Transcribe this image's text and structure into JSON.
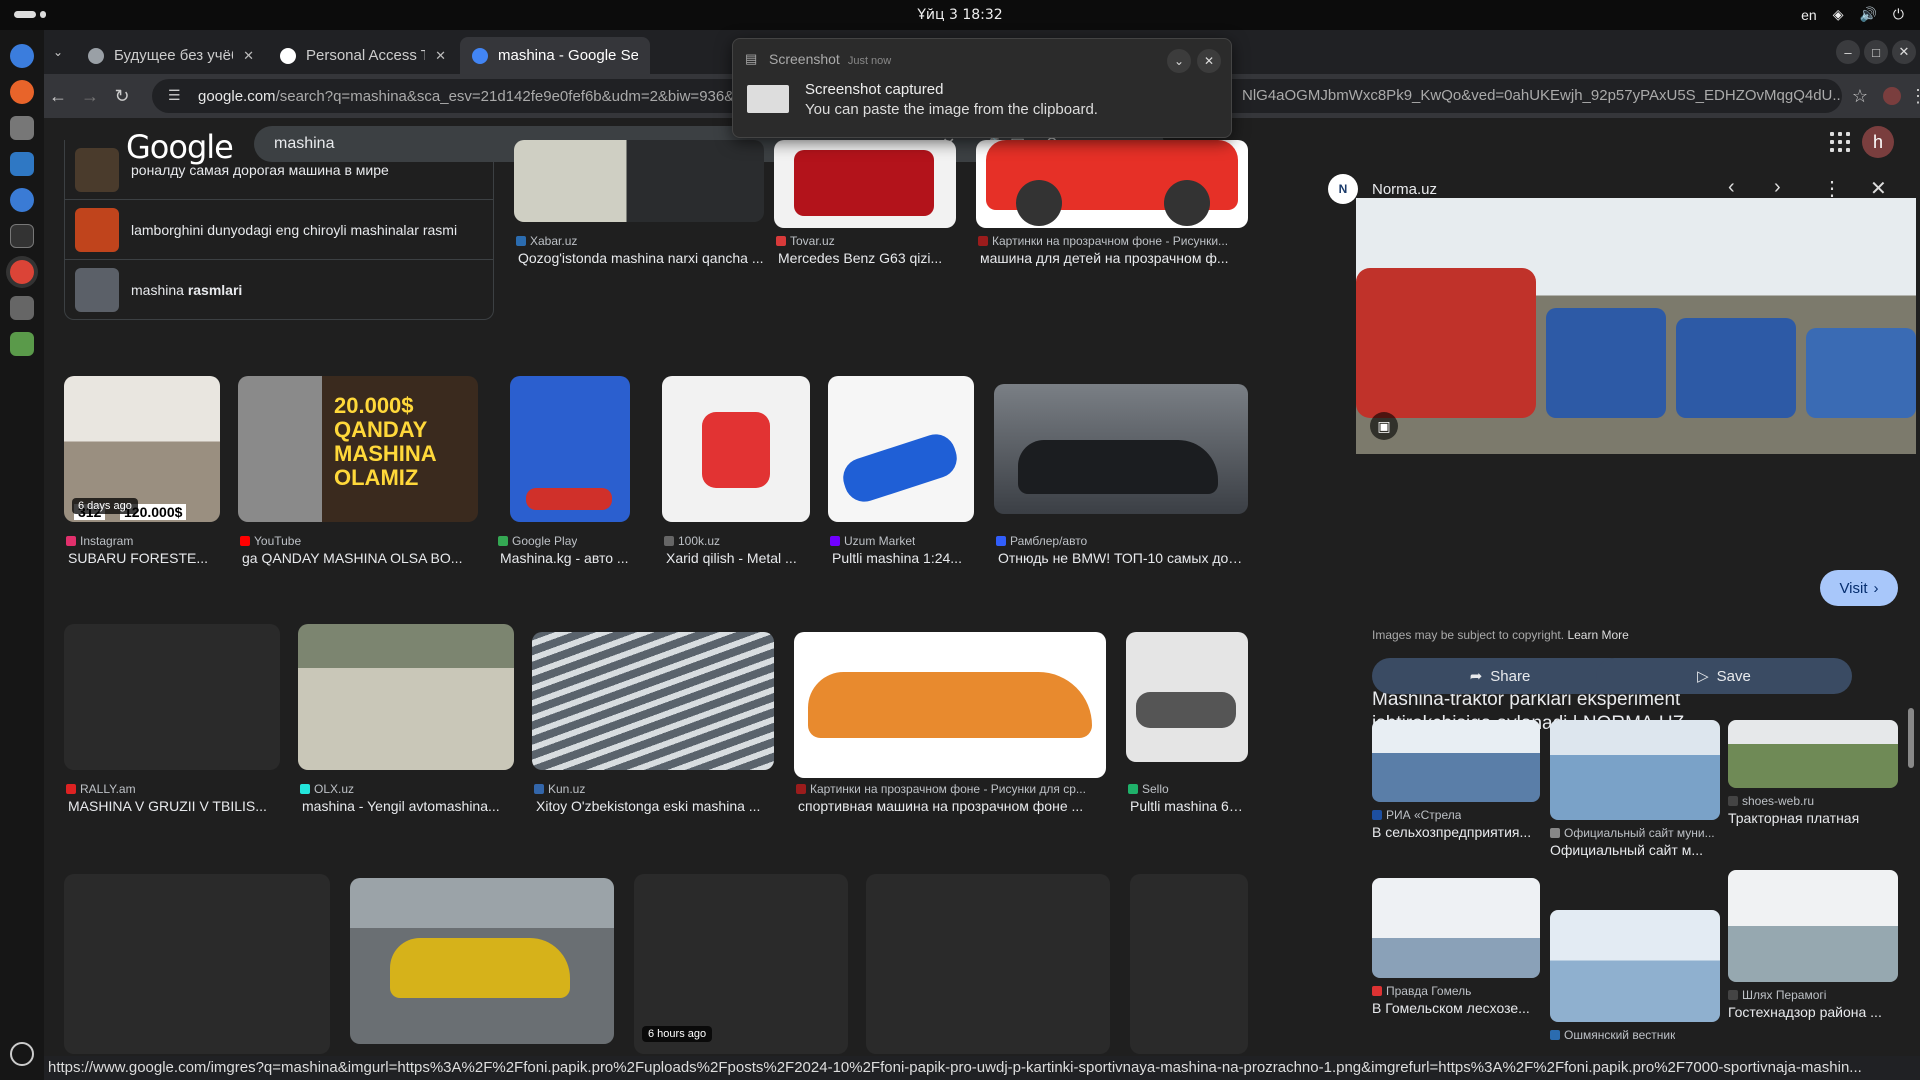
{
  "system": {
    "clock": "Ұйц 3  18:32",
    "lang": "en"
  },
  "tabs": [
    {
      "title": "Будущее без учёбы",
      "fav": "#9aa0a6"
    },
    {
      "title": "Personal Access Tokens (",
      "fav": "#ffffff"
    },
    {
      "title": "mashina - Google Sear",
      "fav": "#4285f4"
    }
  ],
  "url": {
    "host": "google.com",
    "rest": "/search?q=mashina&sca_esv=21d142fe9e0fef6b&udm=2&biw=936&bih=9",
    "tail": "NlG4aOGMJbmWxc8Pk9_KwQo&ved=0ahUKEwjh_92p57yPAxU5S_EDHZOvMqgQ4dU..."
  },
  "search": {
    "logo": "Google",
    "query": "mashina"
  },
  "related": [
    {
      "text": "роналду самая дорогая машина в мире",
      "color": "#4a3b2c"
    },
    {
      "text": "lamborghini dunyodagi eng chiroyli mashinalar rasmi",
      "color": "#c0441c"
    },
    {
      "text": "mashina ",
      "bold": "rasmlari",
      "color": "#5b6068"
    }
  ],
  "row0": [
    {
      "source": "Xabar.uz",
      "title": "Qozog'istonda mashina narxi qancha ...",
      "color": "#6b6f66",
      "icon": "#2b6cb0"
    },
    {
      "source": "Tovar.uz",
      "title": "Mercedes Benz G63 qizi...",
      "color": "#b3131b",
      "icon": "#d83a3a"
    },
    {
      "source": "Картинки на прозрачном фоне - Рисунки...",
      "title": "машина для детей на прозрачном ф...",
      "color": "#e63027",
      "icon": "#9b1c1c"
    }
  ],
  "row1": [
    {
      "source": "Instagram",
      "title": "SUBARU FORESTE...",
      "color": "#9a8f80",
      "icon": "#e1306c",
      "badge": "6 days ago",
      "overlay1": "312",
      "overlay2": "120.000$"
    },
    {
      "source": "YouTube",
      "title": "ga QANDAY MASHINA OLSA BO...",
      "color": "#3a2a1e",
      "icon": "#ff0000",
      "overlay1": "20.000$ QANDAY MASHINA OLAMIZ"
    },
    {
      "source": "Google Play",
      "title": "Mashina.kg - авто ...",
      "color": "#2b5fcf",
      "icon": "#34a853"
    },
    {
      "source": "100k.uz",
      "title": "Xarid qilish - Metal ...",
      "color": "#f2f2f2",
      "icon": "#666666"
    },
    {
      "source": "Uzum Market",
      "title": "Pultli mashina 1:24...",
      "color": "#f6f6f6",
      "icon": "#7000ff"
    },
    {
      "source": "Рамблер/авто",
      "title": "Отнюдь не BMW! ТОП-10 самых дороги...",
      "color": "#3b3f45",
      "icon": "#315efb"
    }
  ],
  "row2": [
    {
      "source": "RALLY.am",
      "title": "MASHINA V GRUZII V TBILIS...",
      "color": "#2a2a2a",
      "icon": "#d22"
    },
    {
      "source": "OLX.uz",
      "title": "mashina - Yengil avtomashina...",
      "color": "#c9c7b8",
      "icon": "#23e5db"
    },
    {
      "source": "Kun.uz",
      "title": "Xitoy O'zbekistonga eski mashina ...",
      "color": "#6a737d",
      "icon": "#3366aa"
    },
    {
      "source": "Картинки на прозрачном фоне - Рисунки для ср...",
      "title": "спортивная машина на прозрачном фоне ...",
      "color": "#e88a2e",
      "icon": "#9b1c1c"
    },
    {
      "source": "Sello",
      "title": "Pultli mashina 6108 ...",
      "color": "#e5e5e5",
      "icon": "#1fb16a"
    }
  ],
  "row3": [
    {
      "color": "#2a2a2a"
    },
    {
      "color": "#d6b21a"
    },
    {
      "color": "#2a2a2a",
      "badge": "6 hours ago"
    },
    {
      "color": "#2a2a2a"
    },
    {
      "color": "#2a2a2a"
    }
  ],
  "panel": {
    "site": "Norma.uz",
    "logo": "N",
    "title": "Mashina-traktor parklari eksperiment ishtirokchisiga aylanadi | NORMA.UZ",
    "visit": "Visit",
    "copyright": "Images may be subject to copyright.",
    "learn": "Learn More",
    "share": "Share",
    "save": "Save",
    "similar": [
      {
        "source": "РИА «Стрела",
        "title": "В сельхозпредприятия...",
        "color": "#5a7ea8",
        "icon": "#1d4fa0"
      },
      {
        "source": "Официальный сайт муни...",
        "title": "Официальный сайт м...",
        "color": "#7aa2c8",
        "icon": "#888888"
      },
      {
        "source": "shoes-web.ru",
        "title": "Тракторная платная",
        "color": "#6f8a56",
        "icon": "#444444"
      },
      {
        "source": "Правда Гомель",
        "title": "В Гомельском лесхозе...",
        "color": "#8aa1b8",
        "icon": "#d33"
      },
      {
        "source": "Ошмянский вестник",
        "title": "",
        "color": "#8fb0cf",
        "icon": "#2b6cb0"
      },
      {
        "source": "Шлях Перамогі",
        "title": "Гостехнадзор района ...",
        "color": "#96a8b0",
        "icon": "#444444"
      }
    ]
  },
  "notification": {
    "app": "Screenshot",
    "time": "Just now",
    "title": "Screenshot captured",
    "body": "You can paste the image from the clipboard."
  },
  "status": "https://www.google.com/imgres?q=mashina&imgurl=https%3A%2F%2Ffoni.papik.pro%2Fuploads%2Fposts%2F2024-10%2Ffoni-papik-pro-uwdj-p-kartinki-sportivnaya-mashina-na-prozrachno-1.png&imgrefurl=https%3A%2F%2Ffoni.papik.pro%2F7000-sportivnaja-mashin..."
}
